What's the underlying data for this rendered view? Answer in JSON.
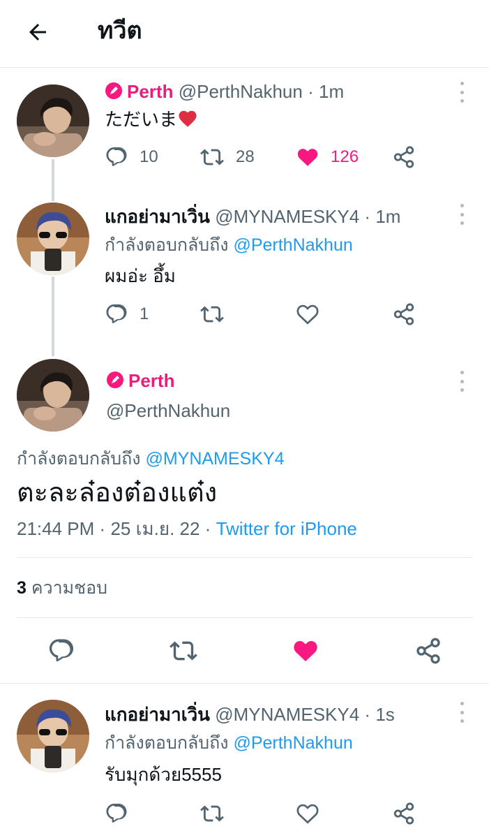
{
  "header": {
    "title": "ทวีต",
    "back_icon": "arrow-left-icon"
  },
  "colors": {
    "pink": "#f91880",
    "link": "#1d9bf0",
    "muted": "#536471",
    "divider": "#e6e9ec"
  },
  "tweet1": {
    "name": "Perth",
    "handle": "@PerthNakhun",
    "sep": "·",
    "time": "1m",
    "text": "ただいま",
    "replies": "10",
    "retweets": "28",
    "likes": "126",
    "liked": true
  },
  "tweet2": {
    "name": "แกอย่ามาเวิ่น",
    "handle": "@MYNAMESKY4",
    "sep": "·",
    "time": "1m",
    "reply_prefix": "กำลังตอบกลับถึง",
    "reply_to": "@PerthNakhun",
    "text": "ผมอ่ะ อึ้ม",
    "replies": "1"
  },
  "main_tweet": {
    "name": "Perth",
    "handle": "@PerthNakhun",
    "reply_prefix": "กำลังตอบกลับถึง",
    "reply_to": "@MYNAMESKY4",
    "text": "ตะละล๋องต๋องแต๋ง",
    "time": "21:44 PM",
    "sep1": "·",
    "date": "25 เม.ย. 22",
    "sep2": "·",
    "client": "Twitter for iPhone",
    "like_count": "3",
    "like_label": "ความชอบ",
    "liked": true
  },
  "tweet3": {
    "name": "แกอย่ามาเวิ่น",
    "handle": "@MYNAMESKY4",
    "sep": "·",
    "time": "1s",
    "reply_prefix": "กำลังตอบกลับถึง",
    "reply_to": "@PerthNakhun",
    "text": "รับมุกด้วย5555"
  }
}
